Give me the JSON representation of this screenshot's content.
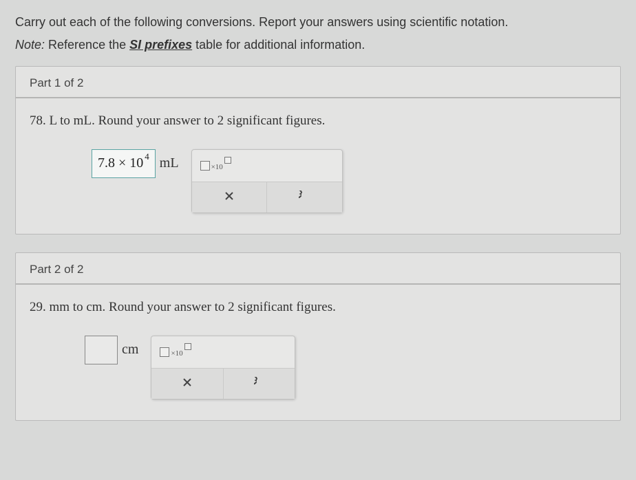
{
  "intro": "Carry out each of the following conversions. Report your answers using scientific notation.",
  "note_prefix": "Note:",
  "note_mid": " Reference the ",
  "note_link": "SI prefixes",
  "note_suffix": " table for additional information.",
  "part1": {
    "header": "Part 1 of 2",
    "question_num": "78.",
    "question_text": " L to mL. Round your answer to 2 significant figures.",
    "answer_coef": "7.8 × 10",
    "answer_exp": "4",
    "unit": "mL",
    "sci_label": "×10"
  },
  "part2": {
    "header": "Part 2 of 2",
    "question_num": "29.",
    "question_text": " mm to cm. Round your answer to 2 significant figures.",
    "unit": "cm",
    "sci_label": "×10"
  }
}
